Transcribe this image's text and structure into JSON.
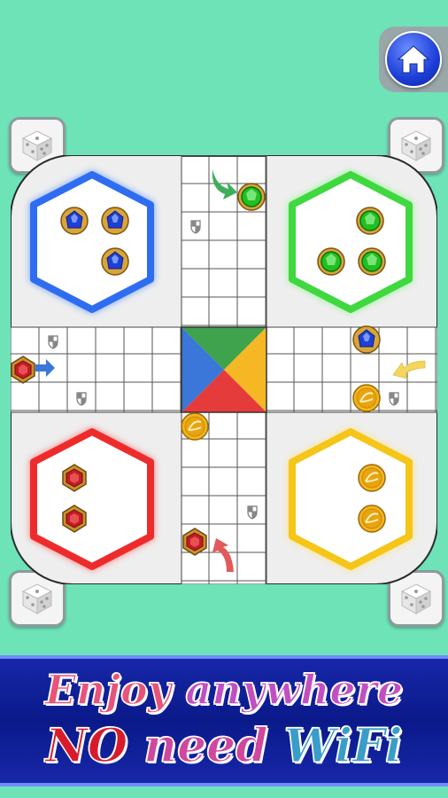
{
  "colors": {
    "background": "#6ee3b8",
    "board": "#f0f0f0",
    "blue": "#2f6df0",
    "green": "#3fd83f",
    "red": "#ee2b2b",
    "yellow": "#f5c518",
    "banner": "#1727a8"
  },
  "header": {
    "home_icon": "home-icon"
  },
  "dice": {
    "icon": "dice-icon",
    "players": [
      "blue",
      "green",
      "red",
      "yellow"
    ]
  },
  "board": {
    "bases": [
      {
        "color": "blue",
        "pieces_in_base": 3
      },
      {
        "color": "green",
        "pieces_in_base": 3
      },
      {
        "color": "red",
        "pieces_in_base": 2
      },
      {
        "color": "yellow",
        "pieces_in_base": 2
      }
    ],
    "pieces_on_track": [
      {
        "color": "green",
        "location": "top arm, start square"
      },
      {
        "color": "blue",
        "location": "right arm, top row near center"
      },
      {
        "color": "yellow",
        "location": "right arm, bottom row near center"
      },
      {
        "color": "yellow",
        "location": "bottom arm, top near center"
      },
      {
        "color": "red",
        "location": "left arm, start square"
      },
      {
        "color": "red",
        "location": "bottom arm, start square"
      }
    ]
  },
  "promo": {
    "line1_word1": "Enjoy",
    "line1_word2": "anywhere",
    "line2_word1": "NO",
    "line2_word2": "need",
    "line2_word3": "WiFi"
  }
}
